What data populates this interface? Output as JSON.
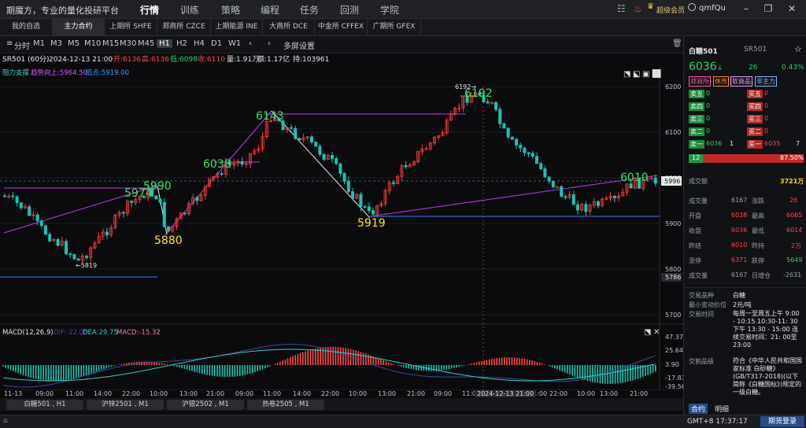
{
  "titlebar": {
    "app_title": "期魔方，专业的量化投研平台",
    "nav": [
      "行情",
      "训练",
      "策略",
      "编程",
      "任务",
      "回测",
      "学院"
    ],
    "active_nav": "行情",
    "member": "超级会员",
    "user": "qmfQu"
  },
  "exchange_tabs": [
    "我的自选",
    "主力合约",
    "上期所 SHFE",
    "郑商所 CZCE",
    "上期能源 INE",
    "大商所 DCE",
    "中金所 CFFEX",
    "广期所 GFEX"
  ],
  "active_exchange": "主力合约",
  "periods": [
    "分时",
    "M1",
    "M3",
    "M5",
    "M10",
    "M15",
    "M30",
    "M45",
    "H1",
    "H2",
    "H4",
    "D1",
    "W1"
  ],
  "active_period": "H1",
  "multi_screen": "多屏设置",
  "bar_info": {
    "symbol": "SR501 (60分)",
    "datetime": "2024-12-13 21:00",
    "open": "开:6136",
    "high": "高:6136",
    "low": "低:6098",
    "close": "收:6110",
    "volume": "量:1.91万",
    "amount": "额:1.17亿",
    "oi": "持:103961"
  },
  "legend": {
    "support": "阻力支撑",
    "trend": "趋势向上:5964.50",
    "low": "低点:5919.00"
  },
  "price_axis": [
    "6200",
    "6100",
    "6000",
    "5900",
    "5800",
    "5700"
  ],
  "price_tag": "5996",
  "level_tag": "5786",
  "annotations": {
    "p6192": "6192",
    "p6192_small": "6192→",
    "p6143": "6143",
    "p6038": "6038",
    "p5974": "5974",
    "p5990": "5990",
    "p5880": "5880",
    "p5919": "5919",
    "p6010": "6010",
    "p5819": "←5819"
  },
  "macd": {
    "title": "MACD(12,26,9)",
    "dif": "DIF:-22.05",
    "dea": "DEA:29.75",
    "macd": "MACD:-15.32",
    "axis": [
      "47.37",
      "25.64",
      "3.90",
      "-17.83",
      "-39.56"
    ]
  },
  "time_axis": [
    "11-13",
    "09:00",
    "11:00",
    "14:00",
    "22:00",
    "10:00",
    "13:00",
    "21:00",
    "09:00",
    "11:00",
    "14:00",
    "22:00",
    "10:00",
    "13:00",
    "21:00",
    "09:00",
    "11:0",
    "14:00",
    "22:00",
    "10:00",
    "13:00",
    "21:00",
    "09:00"
  ],
  "crosshair_time": "2024-12-13 21:00",
  "bottom_tabs": [
    "白糖501 , H1",
    "沪锌2501 , M1",
    "沪银2502 , M1",
    "热卷2505 , M1"
  ],
  "status": {
    "clock": "GMT+8 17:37:17",
    "login": "期货登录"
  },
  "quote": {
    "name": "白糖501",
    "code": "SR501",
    "price": "6036",
    "change": "26",
    "change_pct": "0.43%",
    "exchange": "郑商所",
    "tag1": "休市",
    "tag2": "软商品",
    "tag3": "非主力",
    "asks": [
      {
        "label": "卖五",
        "price": "0",
        "vol": ""
      },
      {
        "label": "卖四",
        "price": "0",
        "vol": ""
      },
      {
        "label": "卖三",
        "price": "0",
        "vol": ""
      },
      {
        "label": "卖二",
        "price": "0",
        "vol": ""
      },
      {
        "label": "卖一",
        "price": "6036",
        "vol": "1"
      }
    ],
    "bids": [
      {
        "label": "买五",
        "price": "0",
        "vol": ""
      },
      {
        "label": "买四",
        "price": "0",
        "vol": ""
      },
      {
        "label": "买三",
        "price": "0",
        "vol": ""
      },
      {
        "label": "买二",
        "price": "0",
        "vol": ""
      },
      {
        "label": "买一",
        "price": "6035",
        "vol": "7"
      }
    ],
    "ratio_left": "12",
    "ratio_right": "87.50%",
    "turnover_label": "成交额",
    "turnover": "3721万",
    "stats": [
      [
        "成交量",
        "6167",
        "涨跌",
        "26"
      ],
      [
        "开盘",
        "6038",
        "最高",
        "6065"
      ],
      [
        "收盘",
        "6036",
        "最低",
        "6014"
      ],
      [
        "昨结",
        "6010",
        "昨持",
        "2万"
      ],
      [
        "涨停",
        "6371",
        "跌停",
        "5649"
      ],
      [
        "成交量",
        "6167",
        "日增仓",
        "-2631"
      ]
    ],
    "info": {
      "variety_label": "交易品种",
      "variety": "白糖",
      "tick_label": "最小变动价位",
      "tick": "2元/吨",
      "time_label": "交易时间",
      "time": "每周一至周五上午 9:00 - 10:15 10:30-11: 30 下午 13:30 - 15:00 连续交易时间：21: 00至23:00",
      "grade_label": "交割品级",
      "grade": "符合《中华人民共和国国家标准 白砂糖》(GB/T317-2018)(以下简称《白糖国标》)规定的一级白糖。"
    },
    "tabs": [
      "合约",
      "明细"
    ]
  }
}
